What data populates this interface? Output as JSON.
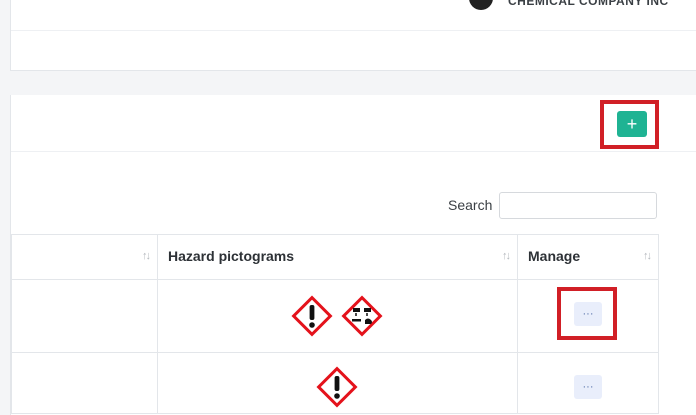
{
  "header": {
    "company_name": "CHEMICAL COMPANY INC"
  },
  "card": {
    "add_button_label": "+"
  },
  "search": {
    "label": "Search",
    "value": "",
    "placeholder": ""
  },
  "table": {
    "columns": [
      {
        "label": "",
        "sort_icon": "↑↓"
      },
      {
        "label": "Hazard pictograms",
        "sort_icon": "↑↓"
      },
      {
        "label": "Manage",
        "sort_icon": "↑↓"
      }
    ],
    "rows": [
      {
        "pictograms": [
          "exclamation-mark-icon",
          "corrosion-icon"
        ],
        "manage_label": "···"
      },
      {
        "pictograms": [
          "exclamation-mark-icon"
        ],
        "manage_label": "···"
      }
    ]
  },
  "colors": {
    "primary": "#1fb393",
    "highlight": "#d11f26",
    "pictogram_border": "#e4121b"
  }
}
